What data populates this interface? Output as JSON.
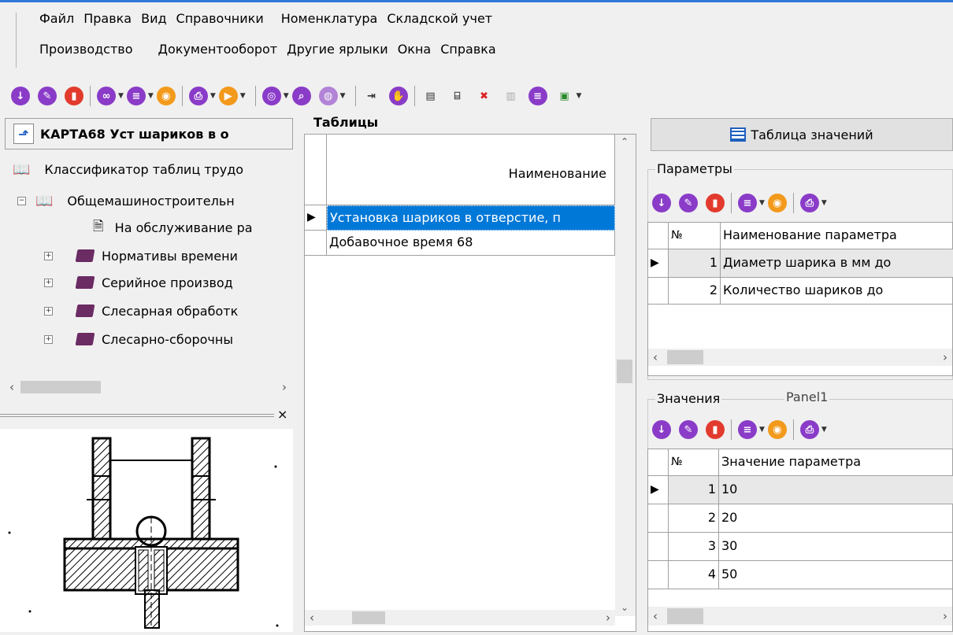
{
  "menu": {
    "row1": [
      "Файл",
      "Правка",
      "Вид",
      "Справочники",
      "Номенклатура",
      "Складской учет"
    ],
    "row2": [
      "Производство",
      "Документооборот",
      "Другие ярлыки",
      "Окна",
      "Справка"
    ]
  },
  "left": {
    "title": "КАРТА68 Уст шариков в о",
    "tree": [
      {
        "label": "Классификатор таблиц трудо",
        "level": 0
      },
      {
        "label": "Общемашиностроительн",
        "level": 1
      },
      {
        "label": "На обслуживание ра",
        "level": 2
      },
      {
        "label": "Нормативы времени",
        "level": 2
      },
      {
        "label": "Серийное производ",
        "level": 2
      },
      {
        "label": "Слесарная обработк",
        "level": 2
      },
      {
        "label": "Слесарно-сборочны",
        "level": 2
      }
    ],
    "close_glyph": "×"
  },
  "tables": {
    "label": "Таблицы",
    "column_header": "Наименование",
    "rows": [
      "Установка шариков в отверстие, п",
      "Добавочное время 68"
    ]
  },
  "right": {
    "values_table_button": "Таблица значений",
    "params": {
      "label": "Параметры",
      "col_num": "№",
      "col_name": "Наименование параметра",
      "rows": [
        {
          "num": "1",
          "name": "Диаметр шарика в мм до"
        },
        {
          "num": "2",
          "name": "Количество шариков до"
        }
      ]
    },
    "values": {
      "label": "Значения",
      "panel_label": "Panel1",
      "col_num": "№",
      "col_value": "Значение параметра",
      "rows": [
        {
          "num": "1",
          "value": "10"
        },
        {
          "num": "2",
          "value": "20"
        },
        {
          "num": "3",
          "value": "30"
        },
        {
          "num": "4",
          "value": "50"
        }
      ]
    }
  },
  "colors": {
    "accent": "#2f7ad8",
    "selection": "#0078d7",
    "icon_purple": "#8a3cc8",
    "icon_red": "#e23b2e",
    "icon_orange": "#f39a1c"
  }
}
